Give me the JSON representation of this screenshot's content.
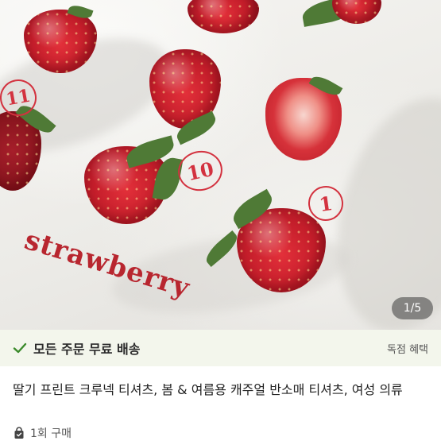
{
  "gallery": {
    "image_text": "strawberry",
    "numbers": [
      "11",
      "10",
      "1"
    ],
    "counter": "1/5"
  },
  "banner": {
    "icon": "check-icon",
    "text": "모든 주문 무료 배송",
    "right_text": "독점 혜택",
    "accent": "#3a8a2a"
  },
  "product": {
    "title": "딸기 프린트 크루넥 티셔츠, 봄 & 여름용 캐주얼 반소매 티셔츠, 여성 의류",
    "purchase_icon": "shopping-bag-icon",
    "purchase_count": "1회 구매"
  }
}
